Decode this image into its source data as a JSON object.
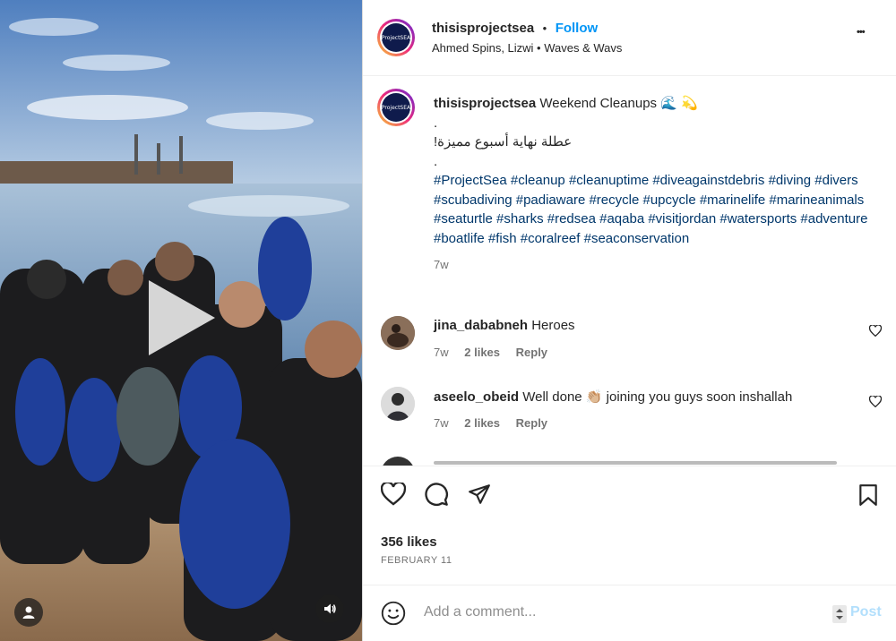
{
  "post": {
    "username": "thisisprojectsea",
    "separator": "•",
    "follow_label": "Follow",
    "audio": "Ahmed Spins, Lizwi • Waves & Wavs",
    "more_label": "•••",
    "logo_text": "ProjectSEA"
  },
  "caption": {
    "username": "thisisprojectsea",
    "text": "Weekend Cleanups 🌊 💫",
    "dot1": ".",
    "arabic": "عطلة نهاية أسبوع مميزة!",
    "dot2": ".",
    "hashtags": "#ProjectSea #cleanup #cleanuptime #diveagainstdebris #diving #divers #scubadiving #padiaware #recycle #upcycle #marinelife #marineanimals #seaturtle #sharks #redsea #aqaba #visitjordan #watersports #adventure #boatlife #fish #coralreef #seaconservation",
    "time": "7w"
  },
  "comments": [
    {
      "username": "jina_dababneh",
      "text": "Heroes",
      "time": "7w",
      "likes": "2 likes",
      "reply": "Reply"
    },
    {
      "username": "aseelo_obeid",
      "text": "Well done 👏🏼 joining you guys soon inshallah",
      "time": "7w",
      "likes": "2 likes",
      "reply": "Reply"
    }
  ],
  "engagement": {
    "likes": "356 likes",
    "date": "FEBRUARY 11"
  },
  "add_comment": {
    "placeholder": "Add a comment...",
    "post_label": "Post"
  },
  "media": {
    "play_icon": "play-icon",
    "user_icon": "user-tag-icon",
    "audio_icon": "speaker-icon"
  },
  "colors": {
    "accent": "#0095f6",
    "hashtag": "#00376b",
    "post_disabled": "#b2dffc",
    "muted": "#737373"
  }
}
